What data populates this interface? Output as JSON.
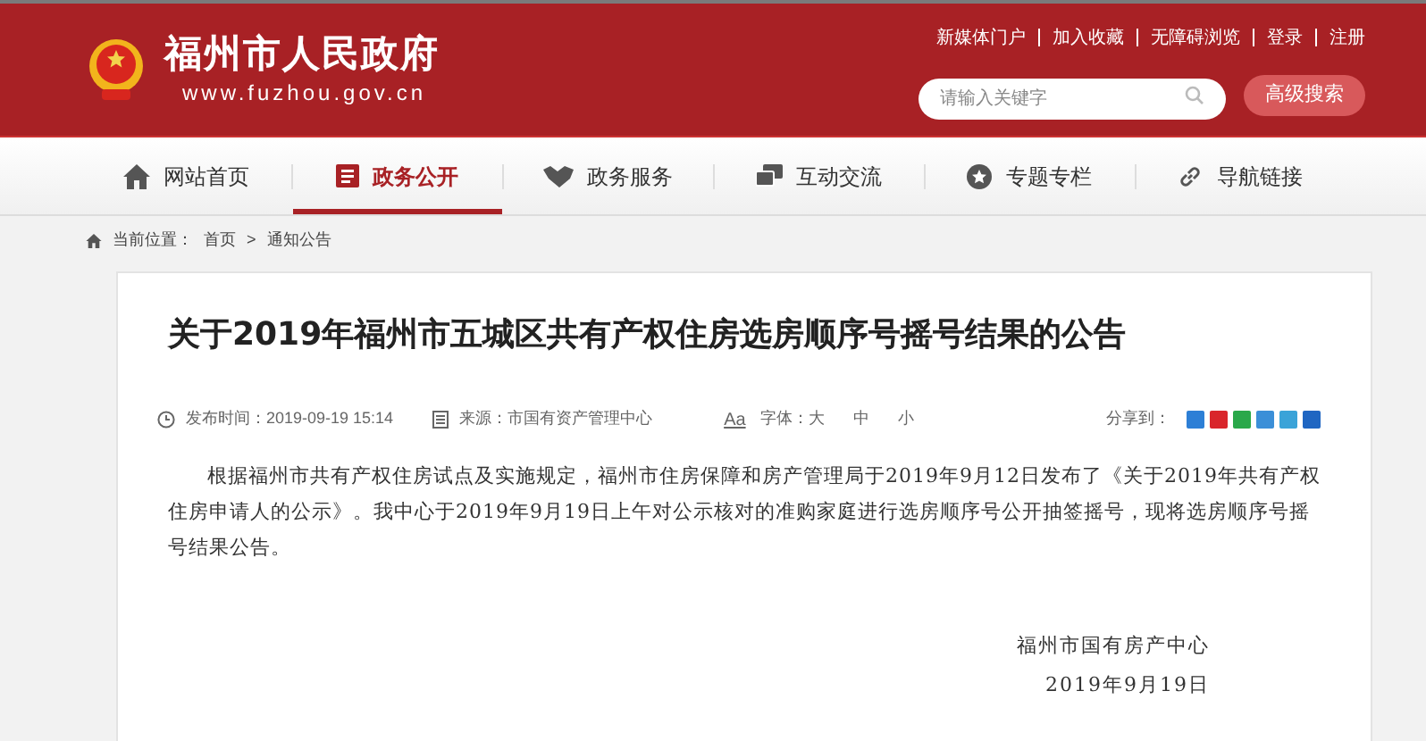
{
  "header": {
    "site_name": "福州市人民政府",
    "domain": "www.fuzhou.gov.cn",
    "top_links": [
      "新媒体门户",
      "加入收藏",
      "无障碍浏览",
      "登录",
      "注册"
    ],
    "search": {
      "placeholder": "请输入关键字"
    },
    "advanced_search": "高级搜索"
  },
  "nav": [
    {
      "label": "网站首页",
      "kind": "home",
      "selected": false
    },
    {
      "label": "政务公开",
      "kind": "doc",
      "selected": true
    },
    {
      "label": "政务服务",
      "kind": "hands",
      "selected": false
    },
    {
      "label": "互动交流",
      "kind": "chat",
      "selected": false
    },
    {
      "label": "专题专栏",
      "kind": "star",
      "selected": false
    },
    {
      "label": "导航链接",
      "kind": "link",
      "selected": false
    }
  ],
  "breadcrumb": {
    "label": "当前位置：",
    "items": [
      "首页",
      "通知公告"
    ],
    "separator": ">"
  },
  "article": {
    "title": "关于2019年福州市五城区共有产权住房选房顺序号摇号结果的公告",
    "published": "发布时间：2019-09-19 15:14",
    "source": "来源：市国有资产管理中心",
    "font_icon": "Aa",
    "font_label": "字体：",
    "font_sizes": [
      "大",
      "中",
      "小"
    ],
    "share_label": "分享到：",
    "share_icons": [
      {
        "color": "#2d7fd6"
      },
      {
        "color": "#d9252b"
      },
      {
        "color": "#2aa84a"
      },
      {
        "color": "#3b8fd8"
      },
      {
        "color": "#3aa3d8"
      },
      {
        "color": "#1f66c2"
      }
    ],
    "body": "根据福州市共有产权住房试点及实施规定，福州市住房保障和房产管理局于2019年9月12日发布了《关于2019年共有产权住房申请人的公示》。我中心于2019年9月19日上午对公示核对的准购家庭进行选房顺序号公开抽签摇号，现将选房顺序号摇号结果公告。",
    "signature": "福州市国有房产中心",
    "date": "2019年9月19日"
  }
}
